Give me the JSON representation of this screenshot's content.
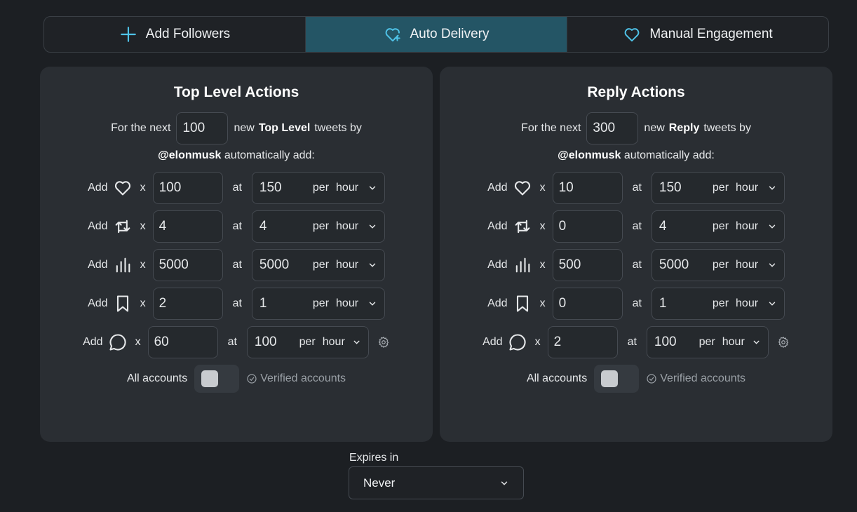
{
  "tabs": [
    {
      "label": "Add Followers",
      "icon": "plus-icon"
    },
    {
      "label": "Auto Delivery",
      "icon": "heart-plus-icon",
      "active": true
    },
    {
      "label": "Manual Engagement",
      "icon": "heart-icon"
    }
  ],
  "common": {
    "for_the_next": "For the next",
    "new": "new",
    "tweets_by": "tweets by",
    "handle": "@elonmusk",
    "automatically_add": "automatically add:",
    "add_label": "Add",
    "x_label": "x",
    "at_label": "at",
    "per_label": "per",
    "unit": "hour",
    "all_accounts": "All accounts",
    "verified_accounts": "Verified accounts"
  },
  "left": {
    "title": "Top Level Actions",
    "count": "100",
    "type": "Top Level",
    "rows": [
      {
        "icon": "heart-icon",
        "qty": "100",
        "rate": "150"
      },
      {
        "icon": "retweet-icon",
        "qty": "4",
        "rate": "4"
      },
      {
        "icon": "views-icon",
        "qty": "5000",
        "rate": "5000"
      },
      {
        "icon": "bookmark-icon",
        "qty": "2",
        "rate": "1"
      },
      {
        "icon": "reply-icon",
        "qty": "60",
        "rate": "100"
      }
    ]
  },
  "right": {
    "title": "Reply Actions",
    "count": "300",
    "type": "Reply",
    "rows": [
      {
        "icon": "heart-icon",
        "qty": "10",
        "rate": "150"
      },
      {
        "icon": "retweet-icon",
        "qty": "0",
        "rate": "4"
      },
      {
        "icon": "views-icon",
        "qty": "500",
        "rate": "5000"
      },
      {
        "icon": "bookmark-icon",
        "qty": "0",
        "rate": "1"
      },
      {
        "icon": "reply-icon",
        "qty": "2",
        "rate": "100"
      }
    ]
  },
  "expires": {
    "label": "Expires in",
    "value": "Never"
  },
  "colors": {
    "active_tab": "#245565",
    "accent_icon": "#4fc3e8",
    "panel": "#2a2e33",
    "background": "#1c1f23"
  }
}
